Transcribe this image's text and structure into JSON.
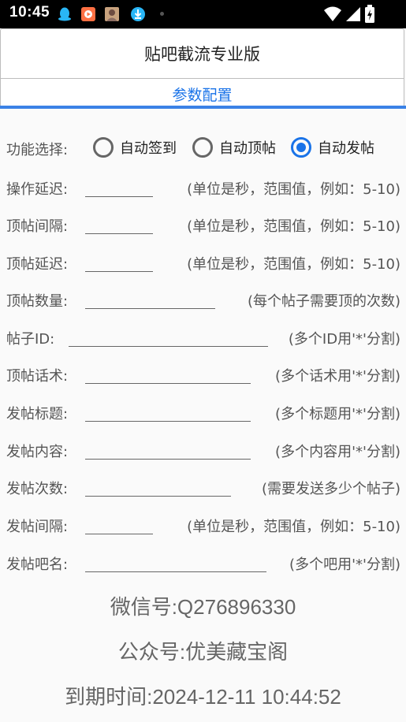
{
  "status_bar": {
    "time": "10:45",
    "icons": [
      "qq-penguin-icon",
      "video-app-icon",
      "avatar-app-icon",
      "download-icon",
      "notification-dot-icon",
      "wifi-icon",
      "signal-icon",
      "battery-icon"
    ]
  },
  "app": {
    "title": "贴吧截流专业版",
    "tab_label": "参数配置",
    "accent_color": "#1a73e8"
  },
  "function_select": {
    "label": "功能选择:",
    "options": [
      {
        "label": "自动签到",
        "checked": false
      },
      {
        "label": "自动顶帖",
        "checked": false
      },
      {
        "label": "自动发帖",
        "checked": true
      }
    ]
  },
  "fields": [
    {
      "label": "操作延迟:",
      "value": "",
      "hint": "(单位是秒，范围值，例如：5-10)"
    },
    {
      "label": "顶帖间隔:",
      "value": "",
      "hint": "(单位是秒，范围值，例如：5-10)"
    },
    {
      "label": "顶帖延迟:",
      "value": "",
      "hint": "(单位是秒，范围值，例如：5-10)"
    },
    {
      "label": "顶帖数量:",
      "value": "",
      "hint": "(每个帖子需要顶的次数)"
    },
    {
      "label": "帖子ID:",
      "value": "",
      "hint": "(多个ID用'*'分割)"
    },
    {
      "label": "顶帖话术:",
      "value": "",
      "hint": "(多个话术用'*'分割)"
    },
    {
      "label": "发帖标题:",
      "value": "",
      "hint": "(多个标题用'*'分割)"
    },
    {
      "label": "发帖内容:",
      "value": "",
      "hint": "(多个内容用'*'分割)"
    },
    {
      "label": "发帖次数:",
      "value": "",
      "hint": "(需要发送多少个帖子)"
    },
    {
      "label": "发帖间隔:",
      "value": "",
      "hint": "(单位是秒，范围值，例如：5-10)"
    },
    {
      "label": "发帖吧名:",
      "value": "",
      "hint": "(多个吧用'*'分割)"
    }
  ],
  "footer": {
    "wechat": "微信号:Q276896330",
    "official_account": "公众号:优美藏宝阁",
    "expiry": "到期时间:2024-12-11 10:44:52"
  }
}
